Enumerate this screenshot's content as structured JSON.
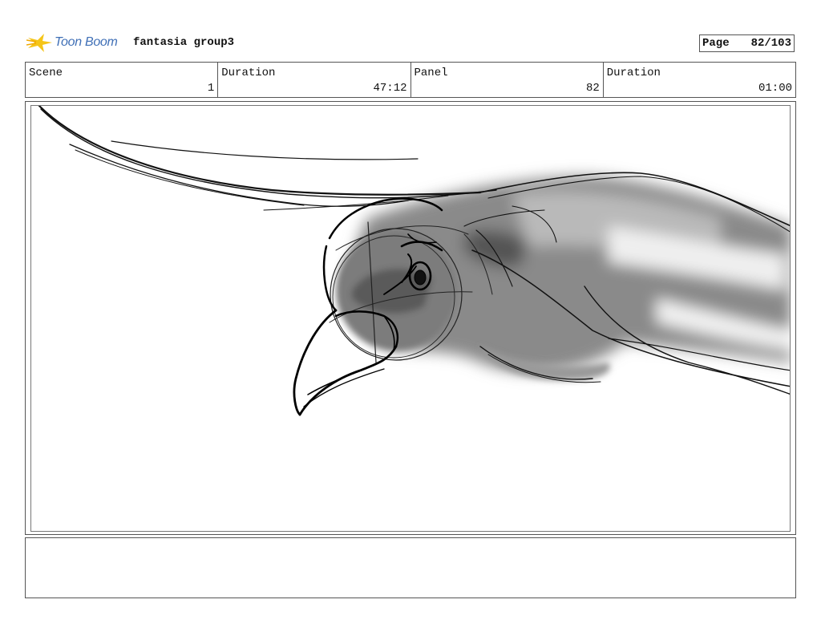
{
  "header": {
    "logo_text": "Toon Boom",
    "project_title": "fantasia group3",
    "page_label": "Page",
    "page_value": "82/103"
  },
  "info": {
    "scene_label": "Scene",
    "scene_value": "1",
    "scene_duration_label": "Duration",
    "scene_duration_value": "47:12",
    "panel_label": "Panel",
    "panel_value": "82",
    "panel_duration_label": "Duration",
    "panel_duration_value": "01:00"
  },
  "notes": {
    "text": ""
  },
  "colors": {
    "logo_star": "#f5c518",
    "logo_text": "#3f6fb6",
    "border": "#555555"
  }
}
